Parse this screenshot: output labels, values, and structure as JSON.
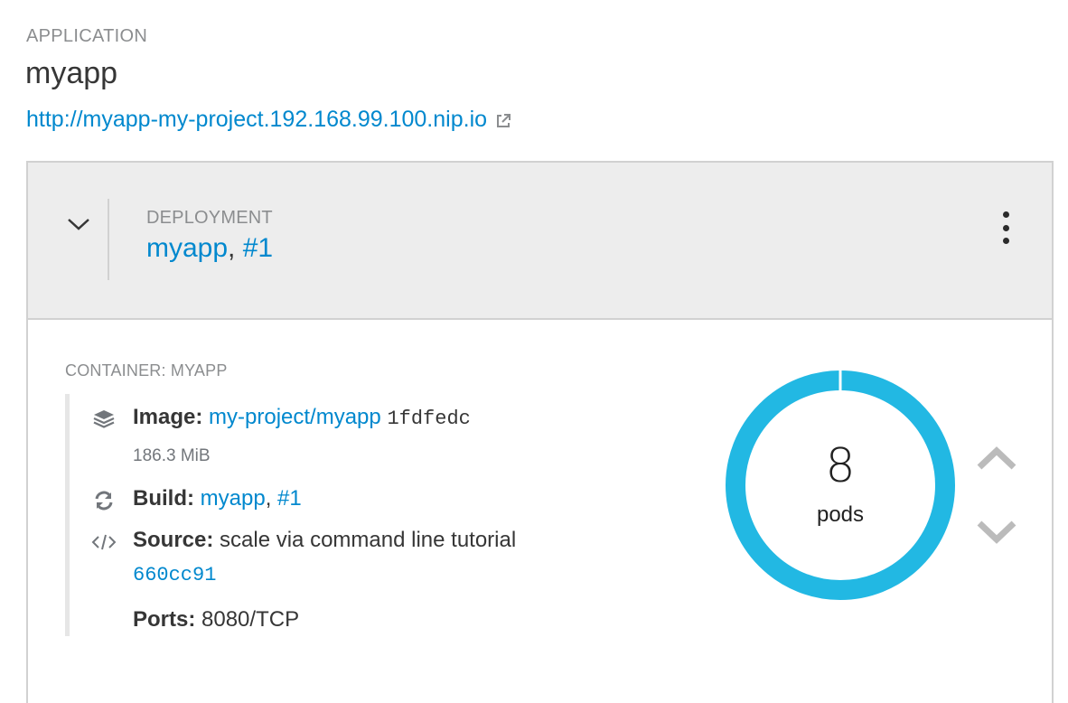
{
  "application": {
    "kicker": "APPLICATION",
    "name": "myapp",
    "url": "http://myapp-my-project.192.168.99.100.nip.io"
  },
  "deployment": {
    "kicker": "DEPLOYMENT",
    "name": "myapp",
    "separator": ", ",
    "revision": "#1"
  },
  "container": {
    "kicker": "CONTAINER: MYAPP",
    "image": {
      "label": "Image:",
      "name": "my-project/myapp",
      "hash": "1fdfedc",
      "size": "186.3 MiB"
    },
    "build": {
      "label": "Build:",
      "name": "myapp",
      "separator": ", ",
      "revision": "#1"
    },
    "source": {
      "label": "Source:",
      "message": "scale via command line tutorial",
      "commit": "660cc91"
    },
    "ports": {
      "label": "Ports:",
      "value": "8080/TCP"
    }
  },
  "pods": {
    "count": "8",
    "label": "pods"
  },
  "colors": {
    "link": "#0088ce",
    "donut": "#22b8e3",
    "header_bg": "#ededed"
  }
}
